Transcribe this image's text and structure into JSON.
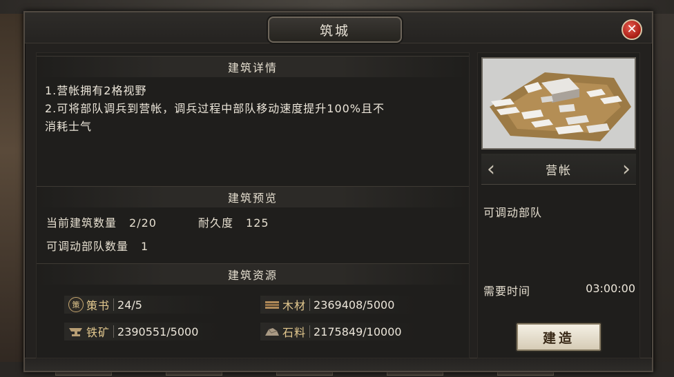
{
  "window": {
    "title": "筑城"
  },
  "details": {
    "heading": "建筑详情",
    "lines": [
      "1.营帐拥有2格视野",
      "2.可将部队调兵到营帐，调兵过程中部队移动速度提升100%且不",
      "消耗士气"
    ]
  },
  "preview": {
    "heading": "建筑预览",
    "count_label": "当前建筑数量",
    "count_value": "2/20",
    "durability_label": "耐久度",
    "durability_value": "125",
    "troops_label": "可调动部队数量",
    "troops_value": "1"
  },
  "resources": {
    "heading": "建筑资源",
    "items": [
      {
        "name": "策书",
        "value": "24/5",
        "icon": "book-icon"
      },
      {
        "name": "木材",
        "value": "2369408/5000",
        "icon": "wood-icon"
      },
      {
        "name": "铁矿",
        "value": "2390551/5000",
        "icon": "anvil-icon"
      },
      {
        "name": "石料",
        "value": "2175849/10000",
        "icon": "stone-icon"
      }
    ]
  },
  "building": {
    "name": "营帐",
    "feature": "可调动部队",
    "time_label": "需要时间",
    "time_value": "03:00:00",
    "build_label": "建造",
    "coin_glyph": "策"
  },
  "colors": {
    "accent": "#e4c98f",
    "close": "#c0241a"
  }
}
